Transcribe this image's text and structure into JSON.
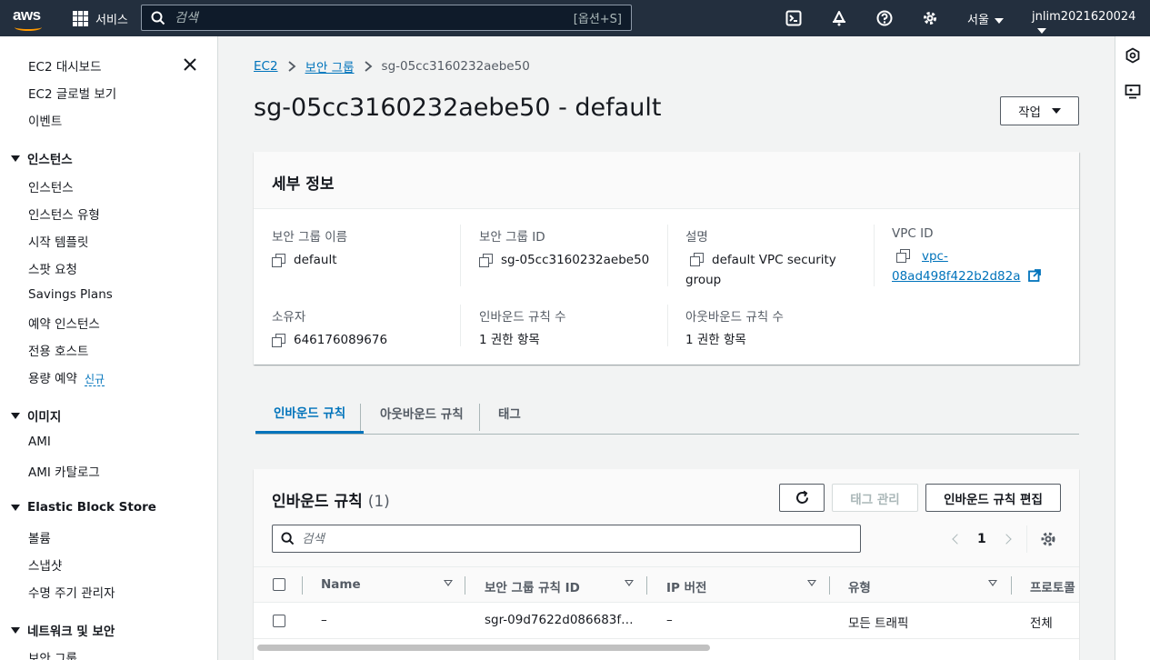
{
  "topnav": {
    "logo_text": "aws",
    "services_label": "서비스",
    "search_placeholder": "검색",
    "search_hint": "[옵션+S]",
    "region": "서울",
    "account": "jnlim2021620024"
  },
  "sidebar": {
    "top_items": [
      "EC2 대시보드",
      "EC2 글로벌 보기",
      "이벤트"
    ],
    "sec_instances": "인스턴스",
    "instances_items": [
      "인스턴스",
      "인스턴스 유형",
      "시작 템플릿",
      "스팟 요청",
      "Savings Plans",
      "예약 인스턴스",
      "전용 호스트",
      "용량 예약"
    ],
    "new_badge": "신규",
    "sec_images": "이미지",
    "images_items": [
      "AMI",
      "AMI 카탈로그"
    ],
    "sec_ebs": "Elastic Block Store",
    "ebs_items": [
      "볼륨",
      "스냅샷",
      "수명 주기 관리자"
    ],
    "sec_network": "네트워크 및 보안",
    "network_items": [
      "보안 그룹"
    ]
  },
  "breadcrumb": {
    "ec2": "EC2",
    "sg": "보안 그룹",
    "current": "sg-05cc3160232aebe50"
  },
  "page_title": "sg-05cc3160232aebe50 - default",
  "actions_label": "작업",
  "details": {
    "heading": "세부 정보",
    "sg_name_label": "보안 그룹 이름",
    "sg_name": "default",
    "sg_id_label": "보안 그룹 ID",
    "sg_id": "sg-05cc3160232aebe50",
    "desc_label": "설명",
    "desc_line1": "default VPC security",
    "desc_line2": "group",
    "vpc_label": "VPC ID",
    "vpc_line1": "vpc-",
    "vpc_line2": "08ad498f422b2d82a",
    "owner_label": "소유자",
    "owner": "646176089676",
    "inbound_count_label": "인바운드 규칙 수",
    "inbound_count": "1 권한 항목",
    "outbound_count_label": "아웃바운드 규칙 수",
    "outbound_count": "1 권한 항목"
  },
  "tabs": [
    "인바운드 규칙",
    "아웃바운드 규칙",
    "태그"
  ],
  "rules": {
    "title": "인바운드 규칙",
    "count": "(1)",
    "manage_tags": "태그 관리",
    "edit_rules": "인바운드 규칙 편집",
    "search_placeholder": "검색",
    "page": "1",
    "columns": [
      "Name",
      "보안 그룹 규칙 ID",
      "IP 버전",
      "유형",
      "프로토콜"
    ],
    "row": [
      "–",
      "sgr-09d7622d086683f…",
      "–",
      "모든 트래픽",
      "전체"
    ]
  }
}
